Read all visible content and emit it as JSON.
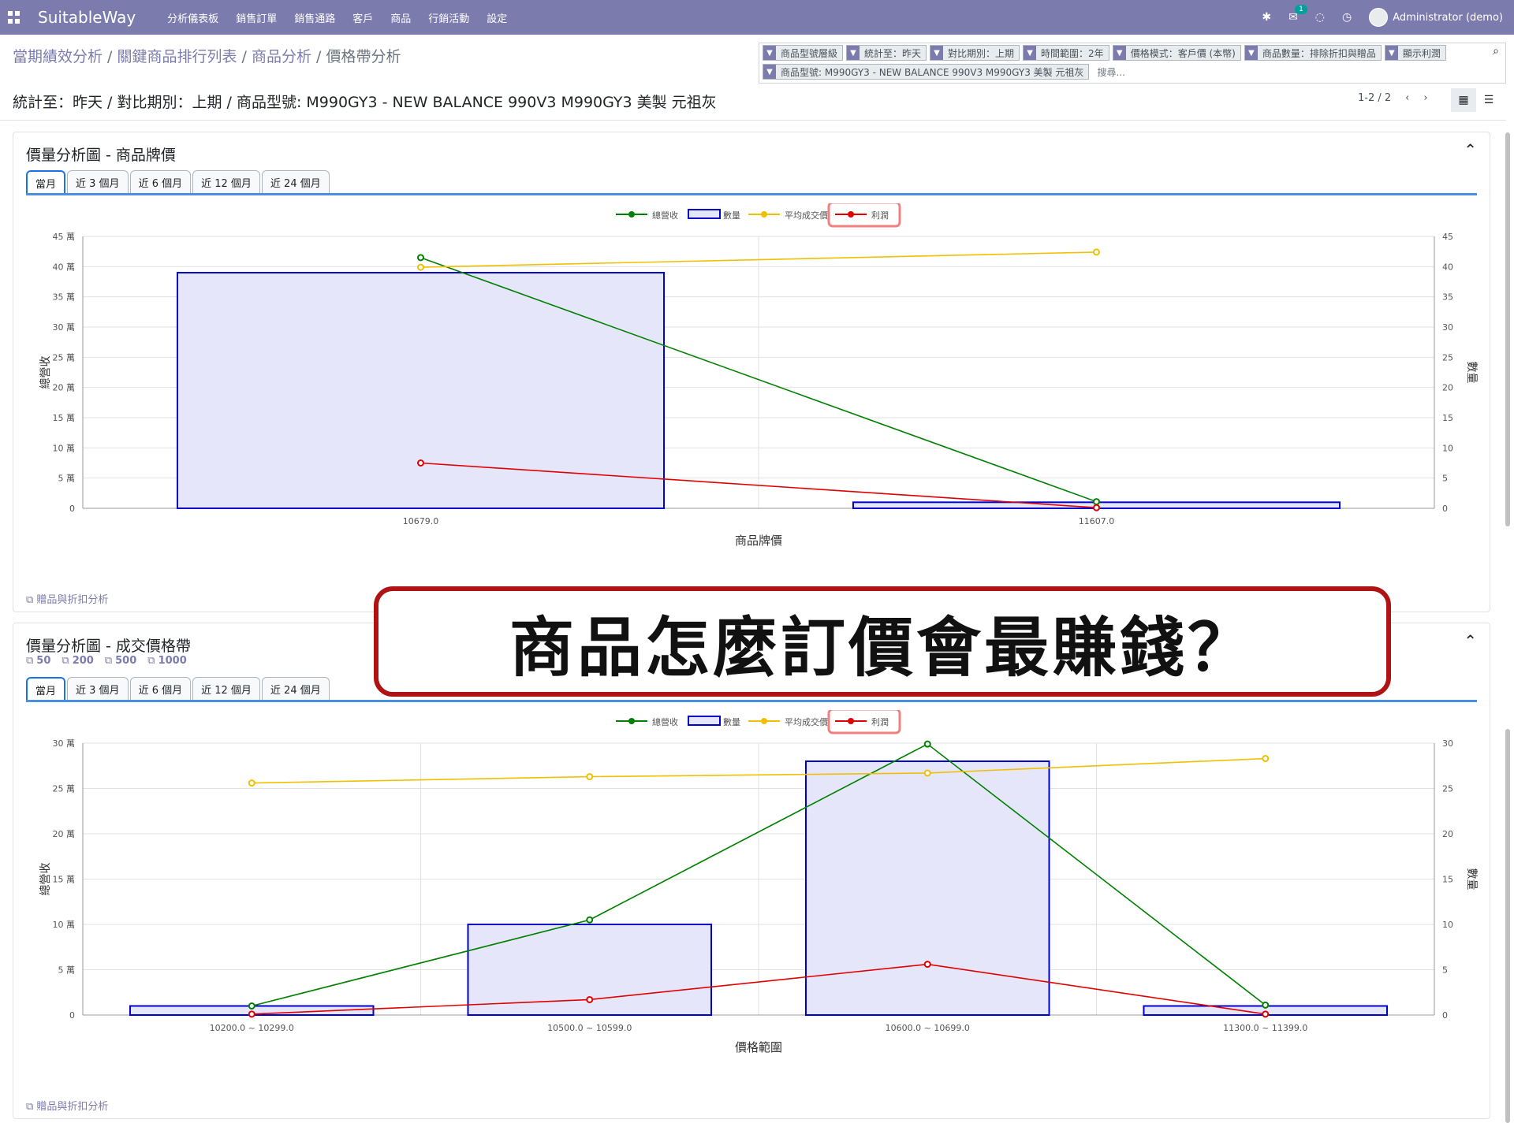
{
  "navbar": {
    "brand": "SuitableWay",
    "menu": [
      "分析儀表板",
      "銷售訂單",
      "銷售通路",
      "客戶",
      "商品",
      "行銷活動",
      "設定"
    ],
    "message_count": "1",
    "user": "Administrator (demo)"
  },
  "breadcrumb": [
    "當期績效分析",
    "關鍵商品排行列表",
    "商品分析",
    "價格帶分析"
  ],
  "subtitle": "統計至：昨天 / 對比期別：上期 / 商品型號: M990GY3 - NEW BALANCE 990V3 M990GY3 美製 元祖灰",
  "search": {
    "facets": [
      "商品型號層級",
      "統計至：昨天",
      "對比期別：上期",
      "時間範圍：2年",
      "價格模式：客戶價 (本幣)",
      "商品數量：排除折扣與贈品",
      "顯示利潤",
      "商品型號: M990GY3 - NEW BALANCE 990V3 M990GY3 美製 元祖灰"
    ],
    "placeholder": "搜尋..."
  },
  "pager": "1-2 / 2",
  "overlay_text": "商品怎麼訂價會最賺錢？",
  "cards": [
    {
      "title": "價量分析圖 - 商品牌價",
      "tabs": [
        "當月",
        "近 3 個月",
        "近 6 個月",
        "近 12 個月",
        "近 24 個月"
      ],
      "active_tab": 0,
      "footer_link": "贈品與折扣分析"
    },
    {
      "title": "價量分析圖 - 成交價格帶",
      "links": [
        "50",
        "200",
        "500",
        "1000"
      ],
      "tabs": [
        "當月",
        "近 3 個月",
        "近 6 個月",
        "近 12 個月",
        "近 24 個月"
      ],
      "active_tab": 0,
      "footer_link": "贈品與折扣分析"
    }
  ],
  "legend_labels": [
    "總營收",
    "數量",
    "平均成交價",
    "利潤"
  ],
  "colors": {
    "revenue": "#008000",
    "quantity_border": "#0000cc",
    "quantity_fill": "#e6e6fa",
    "avg_price": "#f0c000",
    "profit": "#e00000",
    "highlight": "#f08080"
  },
  "chart_data": [
    {
      "type": "bar",
      "categories": [
        "10679.0",
        "11607.0"
      ],
      "xlabel": "商品牌價",
      "ylabel": "總營收",
      "y2label": "數量",
      "ylim": [
        0,
        45
      ],
      "y_unit": "萬",
      "y2lim": [
        0,
        45
      ],
      "y_ticks": [
        "0",
        "5 萬",
        "10 萬",
        "15 萬",
        "20 萬",
        "25 萬",
        "30 萬",
        "35 萬",
        "40 萬",
        "45 萬"
      ],
      "y2_ticks": [
        "0",
        "5",
        "10",
        "15",
        "20",
        "25",
        "30",
        "35",
        "40",
        "45"
      ],
      "series": [
        {
          "name": "數量",
          "kind": "bar",
          "axis": "right",
          "values": [
            39,
            1
          ]
        },
        {
          "name": "總營收",
          "kind": "line",
          "axis": "left",
          "values": [
            41.5,
            1.1
          ]
        },
        {
          "name": "平均成交價",
          "kind": "line",
          "axis": "left",
          "values": [
            39.9,
            42.4
          ]
        },
        {
          "name": "利潤",
          "kind": "line",
          "axis": "left",
          "values": [
            7.5,
            0.1
          ]
        }
      ],
      "legend": "top-center"
    },
    {
      "type": "bar",
      "categories": [
        "10200.0 ~ 10299.0",
        "10500.0 ~ 10599.0",
        "10600.0 ~ 10699.0",
        "11300.0 ~ 11399.0"
      ],
      "xlabel": "價格範圍",
      "ylabel": "總營收",
      "y2label": "數量",
      "ylim": [
        0,
        30
      ],
      "y_unit": "萬",
      "y2lim": [
        0,
        30
      ],
      "y_ticks": [
        "0",
        "5 萬",
        "10 萬",
        "15 萬",
        "20 萬",
        "25 萬",
        "30 萬"
      ],
      "y2_ticks": [
        "0",
        "5",
        "10",
        "15",
        "20",
        "25",
        "30"
      ],
      "series": [
        {
          "name": "數量",
          "kind": "bar",
          "axis": "right",
          "values": [
            1,
            10,
            28,
            1
          ]
        },
        {
          "name": "總營收",
          "kind": "line",
          "axis": "left",
          "values": [
            1.0,
            10.5,
            29.9,
            1.1
          ]
        },
        {
          "name": "平均成交價",
          "kind": "line",
          "axis": "left",
          "values": [
            25.6,
            26.3,
            26.7,
            28.3
          ]
        },
        {
          "name": "利潤",
          "kind": "line",
          "axis": "left",
          "values": [
            0.1,
            1.7,
            5.6,
            0.1
          ]
        }
      ],
      "legend": "top-center"
    }
  ]
}
